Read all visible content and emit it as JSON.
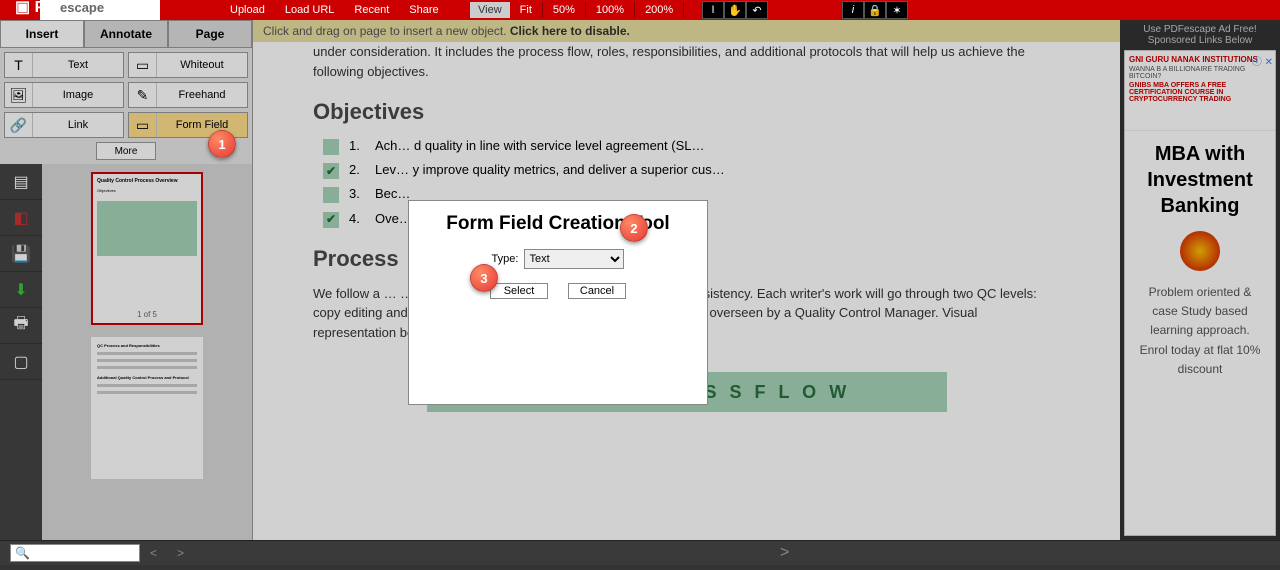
{
  "topbar": {
    "links": [
      "Upload",
      "Load URL",
      "Recent",
      "Share"
    ],
    "view_label": "View",
    "zoom": [
      "Fit",
      "50%",
      "100%",
      "200%"
    ]
  },
  "tabs": {
    "insert": "Insert",
    "annotate": "Annotate",
    "page": "Page"
  },
  "tools": {
    "text": "Text",
    "whiteout": "Whiteout",
    "image": "Image",
    "freehand": "Freehand",
    "link": "Link",
    "formfield": "Form Field",
    "more": "More"
  },
  "hint": {
    "pre": "Click and drag on page to insert a new object. ",
    "bold": "Click here to disable."
  },
  "doc": {
    "intro_tail": "under consideration. It includes the process flow, roles, responsibilities, and additional protocols that will help us achieve the following objectives.",
    "h_obj": "Objectives",
    "objectives": [
      {
        "checked": false,
        "num": "1.",
        "text": "Ach…                                                               d quality in line with service level agreement (SL…"
      },
      {
        "checked": true,
        "num": "2.",
        "text": "Lev…                                                               y improve quality metrics, and deliver a superior cus…"
      },
      {
        "checked": false,
        "num": "3.",
        "text": "Bec…"
      },
      {
        "checked": true,
        "num": "4.",
        "text": "Ove…                                                               ntion in regards to quality"
      }
    ],
    "h_proc": "Process",
    "proc_p": "We follow a …    …    …  process to ensure high content accuracy & consistency. Each writer's work will go through two QC levels: copy editing and proofreading. The entire process will be owned and overseen by a Quality Control Manager. Visual representation below.",
    "banner": "Q C   P R O C E S S   F L O W"
  },
  "thumbs": {
    "page_of": "1 of 5"
  },
  "modal": {
    "title": "Form Field Creation Tool",
    "type_label": "Type:",
    "type_value": "Text",
    "select": "Select",
    "cancel": "Cancel"
  },
  "ads": {
    "header1": "Use PDFescape Ad Free!",
    "header2": "Sponsored Links Below",
    "brand": "GNI GURU NANAK INSTITUTIONS",
    "tag": "WANNA B A BILLIONAIRE TRADING BITCOIN?",
    "sub": "GNIBS MBA OFFERS A FREE CERTIFICATION COURSE IN CRYPTOCURRENCY TRADING",
    "title": "MBA with Investment Banking",
    "desc": "Problem oriented & case Study based learning approach. Enrol today at flat 10% discount"
  },
  "callouts": {
    "c1": "1",
    "c2": "2",
    "c3": "3"
  },
  "footer": {
    "prev": "<",
    "next": ">",
    "right": ">"
  }
}
